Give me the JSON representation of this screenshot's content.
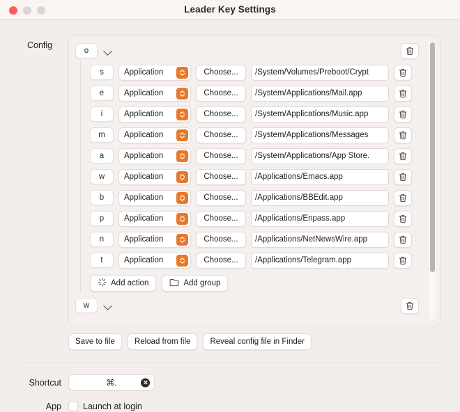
{
  "window": {
    "title": "Leader Key Settings",
    "traffic_lights": [
      "close",
      "minimize",
      "zoom"
    ],
    "accent_color": "#e8792b",
    "background_color": "#f3eeeb"
  },
  "config": {
    "label": "Config",
    "groups": [
      {
        "key": "o",
        "expanded": true,
        "actions": [
          {
            "key": "s",
            "type": "Application",
            "choose_label": "Choose...",
            "path": "/System/Volumes/Preboot/Crypt"
          },
          {
            "key": "e",
            "type": "Application",
            "choose_label": "Choose...",
            "path": "/System/Applications/Mail.app"
          },
          {
            "key": "i",
            "type": "Application",
            "choose_label": "Choose...",
            "path": "/System/Applications/Music.app"
          },
          {
            "key": "m",
            "type": "Application",
            "choose_label": "Choose...",
            "path": "/System/Applications/Messages"
          },
          {
            "key": "a",
            "type": "Application",
            "choose_label": "Choose...",
            "path": "/System/Applications/App Store."
          },
          {
            "key": "w",
            "type": "Application",
            "choose_label": "Choose...",
            "path": "/Applications/Emacs.app"
          },
          {
            "key": "b",
            "type": "Application",
            "choose_label": "Choose...",
            "path": "/Applications/BBEdit.app"
          },
          {
            "key": "p",
            "type": "Application",
            "choose_label": "Choose...",
            "path": "/Applications/Enpass.app"
          },
          {
            "key": "n",
            "type": "Application",
            "choose_label": "Choose...",
            "path": "/Applications/NetNewsWire.app"
          },
          {
            "key": "t",
            "type": "Application",
            "choose_label": "Choose...",
            "path": "/Applications/Telegram.app"
          }
        ],
        "add_action_label": "Add action",
        "add_group_label": "Add group"
      },
      {
        "key": "w",
        "expanded": false,
        "actions": []
      }
    ]
  },
  "file_buttons": [
    {
      "label": "Save to file"
    },
    {
      "label": "Reload from file"
    },
    {
      "label": "Reveal config file in Finder"
    }
  ],
  "shortcut": {
    "label": "Shortcut",
    "value": "⌘.",
    "clear_icon": "clear-circle-icon"
  },
  "app": {
    "label": "App",
    "launch_at_login_label": "Launch at login",
    "launch_at_login_checked": false
  },
  "icons": {
    "chevron_down": "chevron-down-icon",
    "trash": "trash-icon",
    "stepper": "stepper-up-down-icon",
    "sparkle": "sparkle-icon",
    "folder": "folder-icon"
  }
}
